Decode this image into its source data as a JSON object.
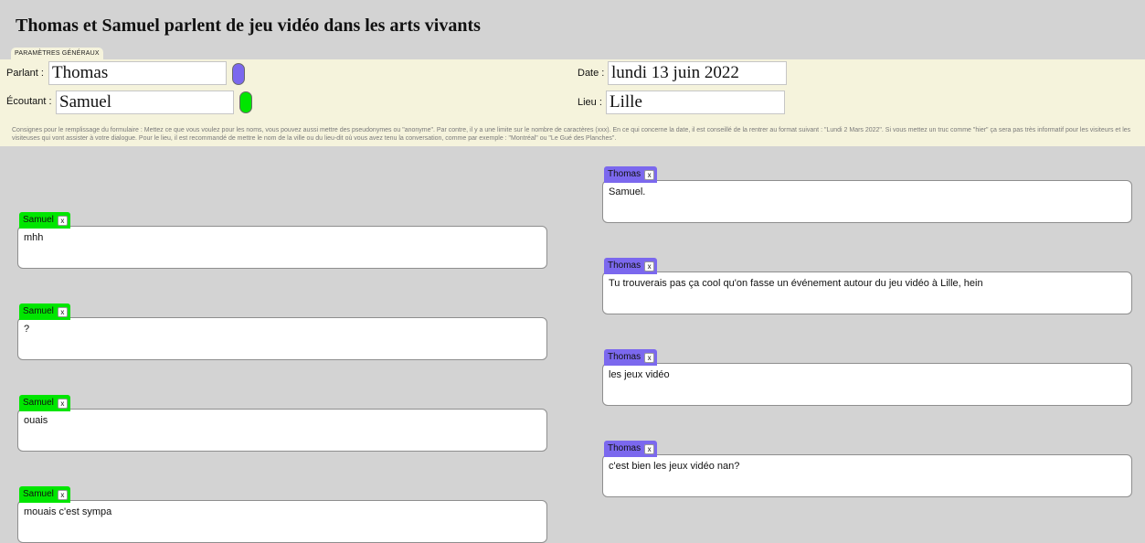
{
  "page": {
    "title": "Thomas et Samuel parlent de jeu vidéo dans les arts vivants"
  },
  "params_tab": {
    "label": "PARAMÈTRES GÉNÉRAUX"
  },
  "params": {
    "parlant_label": "Parlant :",
    "parlant_value": "Thomas",
    "parlant_color": "#7b68ee",
    "ecoutant_label": "Écoutant :",
    "ecoutant_value": "Samuel",
    "ecoutant_color": "#00e600",
    "date_label": "Date :",
    "date_value": "lundi 13 juin 2022",
    "lieu_label": "Lieu :",
    "lieu_value": "Lille",
    "instructions": "Consignes pour le remplissage du formulaire : Mettez ce que vous voulez pour les noms, vous pouvez aussi mettre des pseudonymes ou \"anonyme\". Par contre, il y a une limite sur le nombre de caractères (xxx). En ce qui concerne la date, il est conseillé de la rentrer au format suivant : \"Lundi 2 Mars 2022\". Si vous mettez un truc comme \"hier\" ça sera pas très informatif pour les visiteurs et les visiteuses qui vont assister à votre dialogue. Pour le lieu, il est recommandé de mettre le nom de la ville ou du lieu-dit où vous avez tenu la conversation, comme par exemple : \"Montréal\" ou \"Le Gué des Planches\"."
  },
  "messages": {
    "close_label": "x",
    "left": [
      {
        "speaker": "Samuel",
        "text": "mhh"
      },
      {
        "speaker": "Samuel",
        "text": "?"
      },
      {
        "speaker": "Samuel",
        "text": "ouais"
      },
      {
        "speaker": "Samuel",
        "text": "mouais c'est sympa"
      }
    ],
    "right": [
      {
        "speaker": "Thomas",
        "text": "Samuel."
      },
      {
        "speaker": "Thomas",
        "text": "Tu trouverais pas ça cool qu'on fasse un événement autour du jeu vidéo à Lille, hein"
      },
      {
        "speaker": "Thomas",
        "text": "les jeux vidéo"
      },
      {
        "speaker": "Thomas",
        "text": "c'est bien les jeux vidéo nan?"
      }
    ]
  },
  "colors": {
    "background": "#d3d3d3",
    "params_panel": "#f5f3dc",
    "samuel": "#00e600",
    "thomas": "#7b68ee"
  }
}
